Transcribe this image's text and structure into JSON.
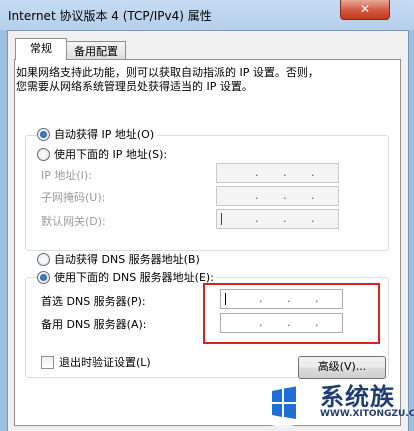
{
  "window": {
    "title": "Internet 协议版本 4 (TCP/IPv4) 属性",
    "close_glyph": "✕"
  },
  "tabs": [
    {
      "label": "常规",
      "selected": true
    },
    {
      "label": "备用配置",
      "selected": false
    }
  ],
  "description": [
    "如果网络支持此功能，则可以获取自动指派的 IP 设置。否则，",
    "您需要从网络系统管理员处获得适当的 IP 设置。"
  ],
  "ip_mode": {
    "auto": {
      "label": "自动获得 IP 地址(O)",
      "selected": true
    },
    "manual": {
      "label": "使用下面的 IP 地址(S):",
      "selected": false
    }
  },
  "ip_fields": [
    {
      "label": "IP 地址(I):",
      "value": " .   .   . "
    },
    {
      "label": "子网掩码(U):",
      "value": " .   .   . "
    },
    {
      "label": "默认网关(D):",
      "value": " .   .   . "
    }
  ],
  "dns_mode": {
    "auto": {
      "label": "自动获得 DNS 服务器地址(B)",
      "selected": false
    },
    "manual": {
      "label": "使用下面的 DNS 服务器地址(E):",
      "selected": true
    }
  },
  "dns_fields": [
    {
      "label": "首选 DNS 服务器(P):",
      "value": ""
    },
    {
      "label": "备用 DNS 服务器(A):",
      "value": ""
    }
  ],
  "validate": {
    "label": "退出时验证设置(L)",
    "checked": false
  },
  "advanced_button": "高级(V)...",
  "watermark": {
    "text": "系统族",
    "url": "WWW.XITONGZU.COM"
  },
  "colors": {
    "highlight": "#d9241e",
    "titlebar": "#b9d3ee"
  }
}
